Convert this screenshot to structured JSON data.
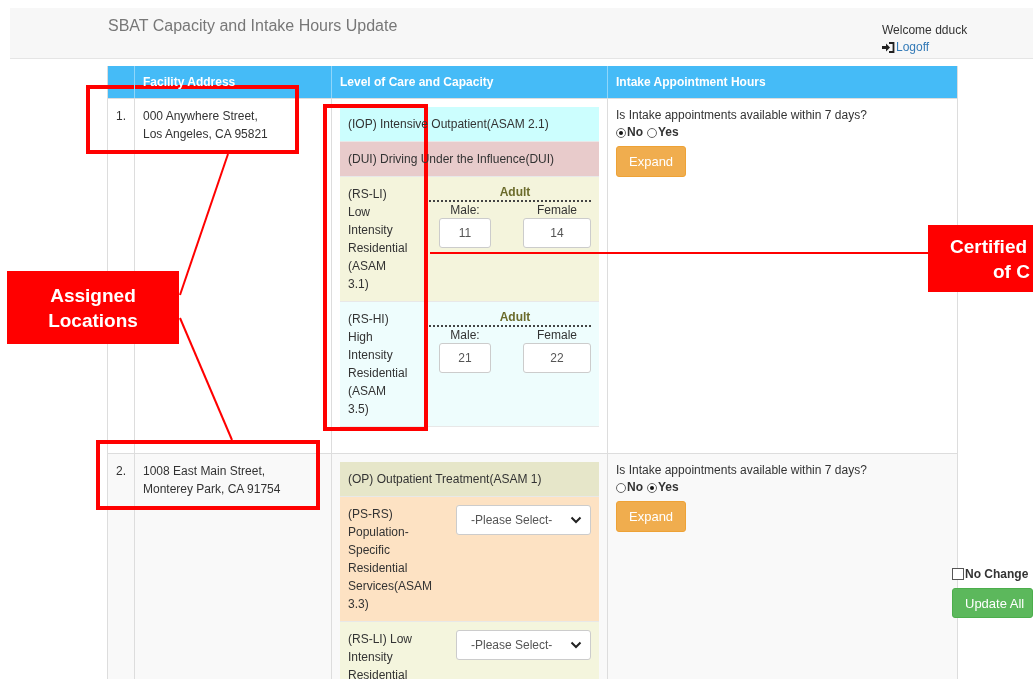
{
  "header": {
    "title": "SBAT Capacity and Intake Hours Update",
    "welcome": "Welcome dduck",
    "logoff": "Logoff"
  },
  "table": {
    "columns": [
      "Facility Address",
      "Level of Care and Capacity",
      "Intake Appointment Hours"
    ],
    "rows": [
      {
        "number": "1.",
        "address": [
          "000 Anywhere Street,",
          "Los Angeles, CA 95821"
        ],
        "care": [
          {
            "kind": "plain",
            "title": "(IOP) Intensive Outpatient(ASAM 2.1)",
            "color": "#ccfefe"
          },
          {
            "kind": "plain",
            "title": "(DUI) Driving Under the Influence(DUI)",
            "color": "#e8cbcb"
          },
          {
            "kind": "capacity",
            "title": "(RS-LI) Low Intensity Residential (ASAM 3.1)",
            "color": "#f4f4dc",
            "group": "Adult",
            "male_label": "Male:",
            "male": "11",
            "female_label": "Female",
            "female": "14"
          },
          {
            "kind": "capacity",
            "title": "(RS-HI) High Intensity Residential (ASAM 3.5)",
            "color": "#eefdfd",
            "group": "Adult",
            "male_label": "Male:",
            "male": "21",
            "female_label": "Female",
            "female": "22"
          }
        ],
        "intake": {
          "question": "Is Intake appointments available within 7 days?",
          "options": [
            {
              "label": "No",
              "selected": true
            },
            {
              "label": "Yes",
              "selected": false
            }
          ],
          "button": "Expand"
        }
      },
      {
        "number": "2.",
        "address": [
          "1008 East Main Street,",
          "Monterey Park, CA 91754"
        ],
        "care": [
          {
            "kind": "plain",
            "title": "(OP) Outpatient Treatment(ASAM 1)",
            "color": "#e6e6c9"
          },
          {
            "kind": "select",
            "title": "(PS-RS) Population-Specific Residential Services(ASAM 3.3)",
            "color": "#fde2c3",
            "placeholder": "-Please Select-"
          },
          {
            "kind": "select",
            "title": "(RS-LI) Low Intensity Residential",
            "color": "#f4f5dd",
            "placeholder": "-Please Select-"
          }
        ],
        "intake": {
          "question": "Is Intake appointments available within 7 days?",
          "options": [
            {
              "label": "No",
              "selected": false
            },
            {
              "label": "Yes",
              "selected": true
            }
          ],
          "button": "Expand"
        }
      }
    ]
  },
  "no_changes": {
    "label": "No Change",
    "checked": false
  },
  "update_button": "Update All",
  "callouts": [
    {
      "lines": [
        "Assigned",
        "Locations"
      ]
    },
    {
      "lines": [
        "Certified",
        "of C"
      ]
    }
  ]
}
